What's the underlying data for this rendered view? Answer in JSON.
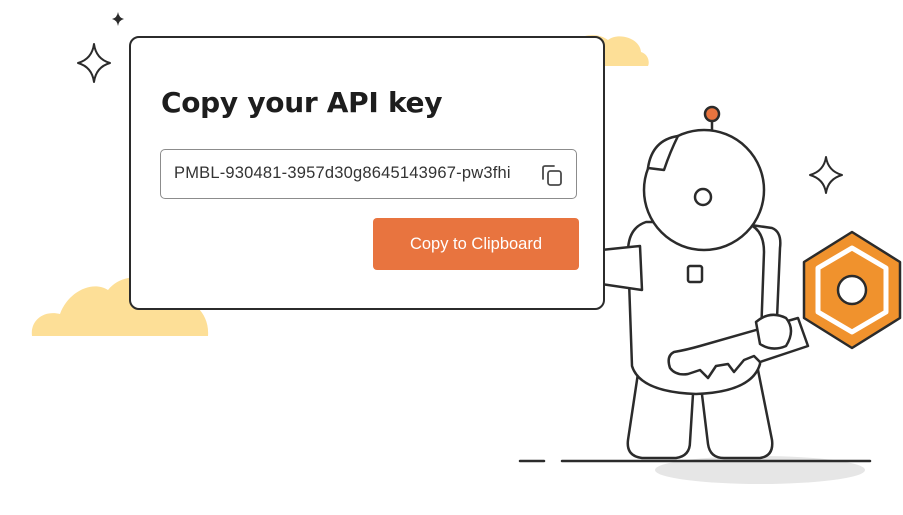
{
  "card": {
    "title": "Copy your API key",
    "api_key": "PMBL-930481-3957d30g8645143967-pw3fhi",
    "copy_button_label": "Copy to Clipboard"
  },
  "illustration": {
    "character": "astronaut",
    "held_item": "key",
    "icons": [
      "sparkle-icon",
      "cloud",
      "copy-icon"
    ]
  },
  "colors": {
    "accent": "#e8743f",
    "cloud": "#fddf97",
    "key": "#f0922d",
    "outline": "#2b2b2b"
  }
}
